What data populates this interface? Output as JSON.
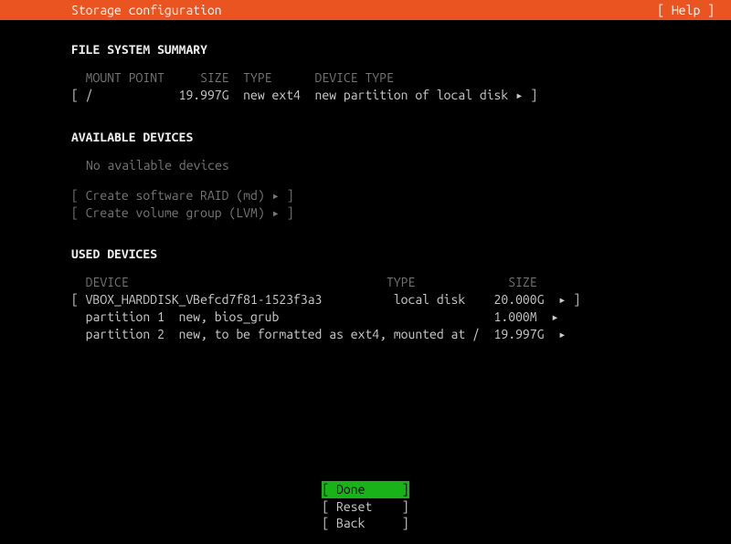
{
  "header": {
    "title": "Storage configuration",
    "help": "[ Help ]"
  },
  "fs_summary": {
    "title": "FILE SYSTEM SUMMARY",
    "header_line": "  MOUNT POINT     SIZE  TYPE      DEVICE TYPE",
    "rows": [
      "[ /            19.997G  new ext4  new partition of local disk ▸ ]"
    ]
  },
  "available": {
    "title": "AVAILABLE DEVICES",
    "none_text": "No available devices",
    "actions": [
      "[ Create software RAID (md) ▸ ]",
      "[ Create volume group (LVM) ▸ ]"
    ]
  },
  "used": {
    "title": "USED DEVICES",
    "header_line": "  DEVICE                                    TYPE             SIZE",
    "device_line": "[ VBOX_HARDDISK_VBefcd7f81-1523f3a3          local disk    20.000G  ▸ ]",
    "partitions": [
      "  partition 1  new, bios_grub                              1.000M  ▸",
      "  partition 2  new, to be formatted as ext4, mounted at /  19.997G  ▸"
    ]
  },
  "buttons": {
    "done": "Done ",
    "reset": "Reset",
    "back": "Back "
  }
}
